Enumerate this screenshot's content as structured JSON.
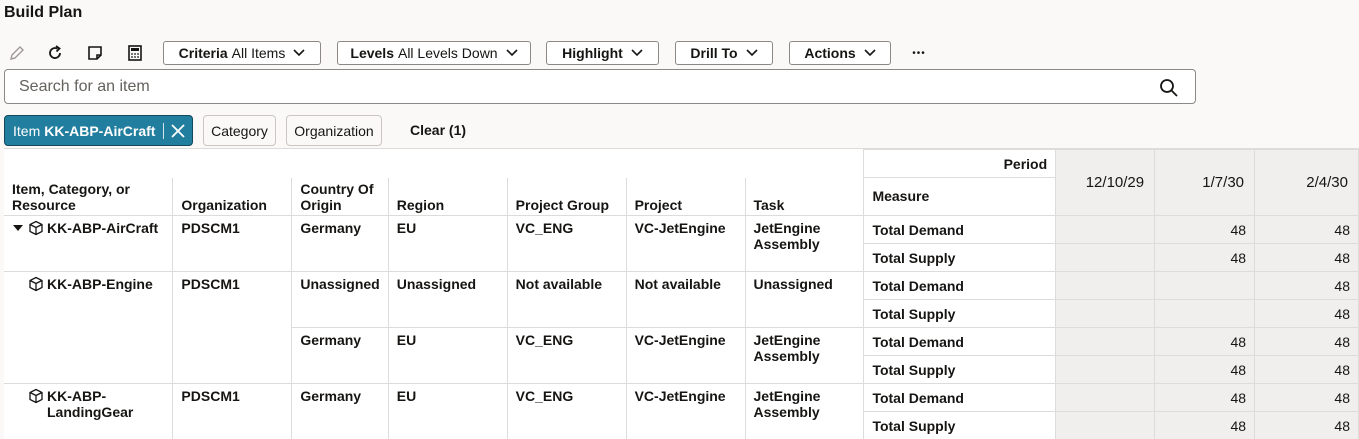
{
  "page": {
    "title": "Build Plan"
  },
  "toolbar": {
    "criteria": {
      "label": "Criteria",
      "value": "All Items"
    },
    "levels": {
      "label": "Levels",
      "value": "All Levels Down"
    },
    "highlight_label": "Highlight",
    "drill_label": "Drill To",
    "actions_label": "Actions",
    "more_label": "•••"
  },
  "search": {
    "placeholder": "Search for an item",
    "value": ""
  },
  "filters": {
    "active": {
      "label": "Item",
      "value": "KK-ABP-AirCraft"
    },
    "category_label": "Category",
    "organization_label": "Organization",
    "clear_label": "Clear (1)"
  },
  "grid": {
    "period_label": "Period",
    "columns": {
      "item": "Item, Category, or Resource",
      "organization": "Organization",
      "country": "Country Of Origin",
      "region": "Region",
      "project_group": "Project Group",
      "project": "Project",
      "task": "Task",
      "measure": "Measure"
    },
    "dates": [
      "12/10/29",
      "1/7/30",
      "2/4/30"
    ],
    "rows": [
      {
        "item": "KK-ABP-AirCraft",
        "organization": "PDSCM1",
        "country": "Germany",
        "region": "EU",
        "project_group": "VC_ENG",
        "project": "VC-JetEngine",
        "task": "JetEngine Assembly",
        "measures": [
          {
            "name": "Total Demand",
            "values": [
              "",
              "48",
              "48"
            ]
          },
          {
            "name": "Total Supply",
            "values": [
              "",
              "48",
              "48"
            ]
          }
        ]
      },
      {
        "item": "KK-ABP-Engine",
        "organization": "PDSCM1",
        "country": "Unassigned",
        "region": "Unassigned",
        "project_group": "Not available",
        "project": "Not available",
        "task": "Unassigned",
        "measures": [
          {
            "name": "Total Demand",
            "values": [
              "",
              "",
              "48"
            ]
          },
          {
            "name": "Total Supply",
            "values": [
              "",
              "",
              "48"
            ]
          }
        ]
      },
      {
        "item": "",
        "organization": "",
        "country": "Germany",
        "region": "EU",
        "project_group": "VC_ENG",
        "project": "VC-JetEngine",
        "task": "JetEngine Assembly",
        "measures": [
          {
            "name": "Total Demand",
            "values": [
              "",
              "48",
              "48"
            ]
          },
          {
            "name": "Total Supply",
            "values": [
              "",
              "48",
              "48"
            ]
          }
        ]
      },
      {
        "item": "KK-ABP-LandingGear",
        "organization": "PDSCM1",
        "country": "Germany",
        "region": "EU",
        "project_group": "VC_ENG",
        "project": "VC-JetEngine",
        "task": "JetEngine Assembly",
        "measures": [
          {
            "name": "Total Demand",
            "values": [
              "",
              "48",
              "48"
            ]
          },
          {
            "name": "Total Supply",
            "values": [
              "",
              "48",
              "48"
            ]
          }
        ]
      }
    ]
  }
}
